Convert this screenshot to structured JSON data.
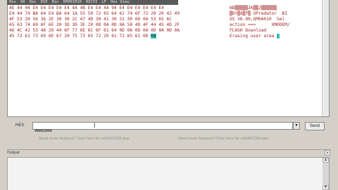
{
  "mode_bar": {
    "items": [
      "Hex",
      "0A",
      "Dec",
      "010",
      "Bin",
      "00001010",
      "ASCII",
      "LF",
      "Hex View"
    ]
  },
  "terminal": {
    "hex_rows": [
      "4E 44 04 E4 E4 E4 E4 E4 4A 4B E4 E4 4A 94 E4 E4 E4 E4 E4 E4",
      "E4 44 74 BA 64 E4 BA 64 1A 55 50 72 65 64 61 74 6F 72 20 20 42 49",
      "4F 53 20 56 36 2E 30 30 2C 47 4D 30 41 30 31 30 0D 0A 53 65 6C",
      "65 63 74 69 6F 6E 20 3D 3D 3E 20 0D 0A 0D 0A 58 4D 4F 44 45 4D 2F",
      "46 4C 41 53 48 20 44 6F 77 6E 6C 6F 61 64 0D 0A 0D 0A 0D 0A 0D 0A",
      "45 72 61 73 69 6E 67 20 75 73 65 72 20 61 72 65 61 0D"
    ],
    "hex_highlight": "0A",
    "ascii_rows": [
      "ND▒▒▒▒▒JK▒▒J▒▒▒▒▒▒",
      "▒Dt▒d▒f▒ UPredator  BI",
      "OS V6.00,GM0A010  Sel",
      "ection ==>      XMODEM/",
      "FLASH Download",
      "Erasing user area"
    ],
    "ascii_highlight": "."
  },
  "send_row": {
    "label": "HEX",
    "input_value": "Welcome",
    "dropdown_icon": "▼",
    "send_label": "Send"
  },
  "ads": [
    "Need more features? Click here for eGHDCDM plus",
    "Need more features? Click here for eGHDCDM plus"
  ],
  "output": {
    "title": "Output",
    "close": "×"
  }
}
